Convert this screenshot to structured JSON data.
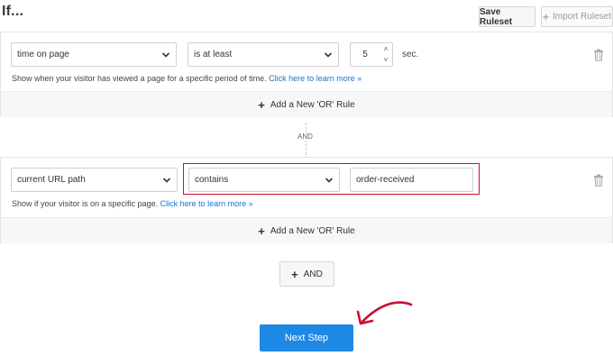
{
  "header": {
    "title": "If...",
    "save_label": "Save Ruleset",
    "import_label": "Import Ruleset",
    "import_plus": "+"
  },
  "groups": [
    {
      "condition": "time on page",
      "operator": "is at least",
      "value": "5",
      "unit": "sec.",
      "help_text": "Show when your visitor has viewed a page for a specific period of time.",
      "help_link": "Click here to learn more »",
      "add_or_label": "Add a New 'OR' Rule"
    },
    {
      "condition": "current URL path",
      "operator": "contains",
      "value": "order-received",
      "help_text": "Show if your visitor is on a specific page.",
      "help_link": "Click here to learn more »",
      "add_or_label": "Add a New 'OR' Rule"
    }
  ],
  "connector": "AND",
  "and_button": "AND",
  "next_button": "Next Step",
  "icons": {
    "plus": "+",
    "spin_up": "˄",
    "spin_down": "˅"
  },
  "colors": {
    "primary": "#1e88e5",
    "highlight": "#c8102e",
    "link": "#1a73c9"
  }
}
